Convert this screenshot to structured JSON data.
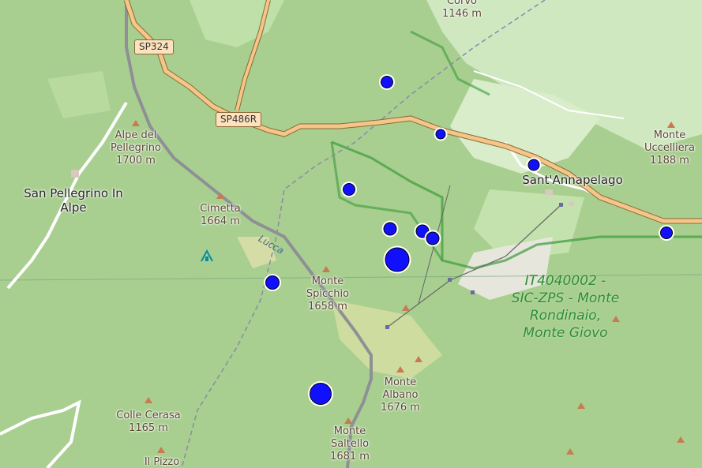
{
  "map": {
    "roads": {
      "sp324": "SP324",
      "sp486r": "SP486R"
    },
    "places": {
      "san_pellegrino": "San Pellegrino In Alpe",
      "sant_annapelago": "Sant'Annapelago"
    },
    "peaks": {
      "corvo": {
        "name": "Corvo",
        "elev": "1146 m"
      },
      "alpe_del_pellegrino": {
        "name": "Alpe del Pellegrino",
        "elev": "1700 m"
      },
      "cimetta": {
        "name": "Cimetta",
        "elev": "1664 m"
      },
      "monte_spicchio": {
        "name": "Monte Spicchio",
        "elev": "1658 m"
      },
      "monte_albano": {
        "name": "Monte Albano",
        "elev": "1676 m"
      },
      "monte_saltello": {
        "name": "Monte Saltello",
        "elev": "1681 m"
      },
      "colle_cerasa": {
        "name": "Colle Cerasa",
        "elev": "1165 m"
      },
      "il_pizzo": {
        "name": "Il Pizzo"
      },
      "monte_uccelliera": {
        "name": "Monte Uccelliera",
        "elev": "1188 m"
      }
    },
    "boundary_name": "Lucca",
    "protected_area": "IT4040002 - SIC-ZPS - Monte Rondinaio, Monte Giovo",
    "colors": {
      "forest": "#a8cf8f",
      "meadow": "#cfe8c0",
      "road": "#f6c688",
      "marker": "#1010ff",
      "protected": "#2e8b3a",
      "peak": "#c87a52"
    },
    "markers_count_shown": 12
  }
}
